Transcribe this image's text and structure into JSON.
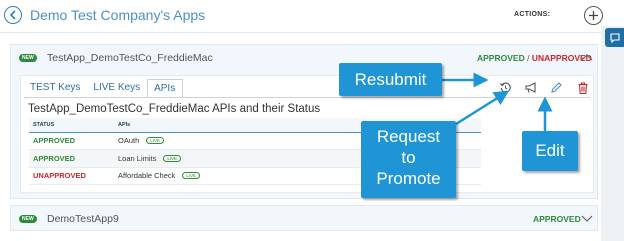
{
  "header": {
    "title": "Demo Test Company's Apps",
    "actions_label": "ACTIONS:",
    "back_icon": "chevron-left-circle-icon",
    "add_icon": "plus-circle-icon"
  },
  "side_rail": {
    "chat_icon": "chat-bubble-icon"
  },
  "apps": [
    {
      "badge": "NEW",
      "name": "TestApp_DemoTestCo_FreddieMac",
      "status_approved": "APPROVED",
      "status_sep": " / ",
      "status_unapproved": "UNAPPROVED",
      "expanded": true,
      "tabs": [
        {
          "label": "TEST Keys",
          "active": false
        },
        {
          "label": "LIVE Keys",
          "active": false
        },
        {
          "label": "APIs",
          "active": true
        }
      ],
      "actions": [
        {
          "name": "resubmit",
          "icon": "history-icon",
          "color": "#555555"
        },
        {
          "name": "request-to-promote",
          "icon": "megaphone-icon",
          "color": "#555555"
        },
        {
          "name": "edit",
          "icon": "pencil-icon",
          "color": "#4a90c8"
        },
        {
          "name": "delete",
          "icon": "trash-icon",
          "color": "#c8272f"
        }
      ],
      "apis_title": "TestApp_DemoTestCo_FreddieMac APIs and their Status",
      "table_headers": [
        "STATUS",
        "APIs"
      ],
      "table_rows": [
        {
          "status": "APPROVED",
          "api": "OAuth",
          "live": "LIVE"
        },
        {
          "status": "APPROVED",
          "api": "Loan Limits",
          "live": "LIVE"
        },
        {
          "status": "UNAPPROVED",
          "api": "Affordable Check",
          "live": "LIVE"
        }
      ]
    },
    {
      "badge": "NEW",
      "name": "DemoTestApp9",
      "status_approved": "APPROVED",
      "expanded": false
    }
  ],
  "callouts": {
    "resubmit": "Resubmit",
    "request_line1": "Request",
    "request_line2": "to",
    "request_line3": "Promote",
    "edit": "Edit"
  },
  "colors": {
    "accent": "#4a90c8",
    "approved": "#2e8b3a",
    "unapproved": "#c8272f",
    "callout": "#1f95d6"
  }
}
